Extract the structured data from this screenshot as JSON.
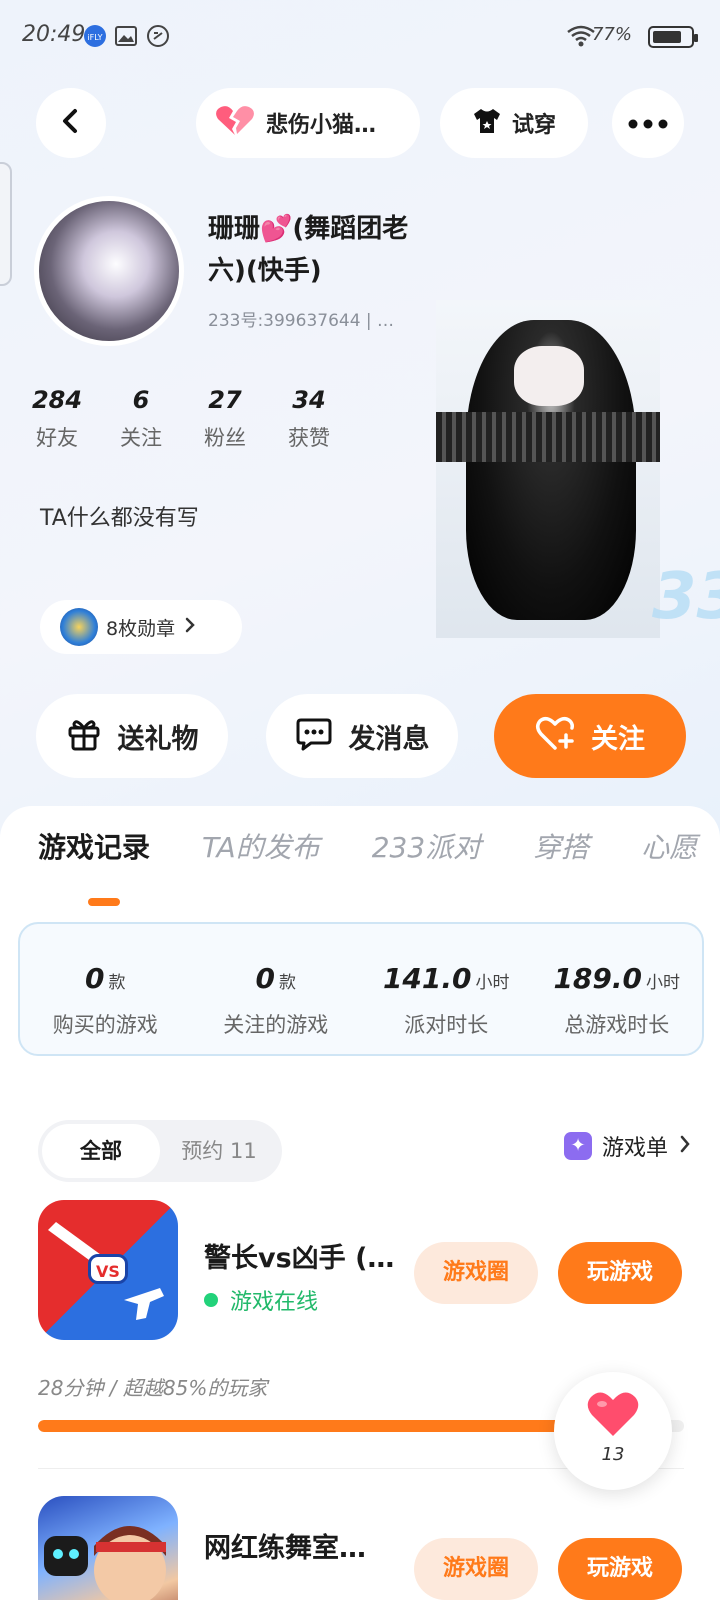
{
  "status_bar": {
    "time": "20:49",
    "battery_percent": "77%",
    "battery_level": 0.77,
    "icons": [
      "ifly-icon",
      "gallery-icon",
      "sync-icon",
      "wifi-icon",
      "battery-icon"
    ]
  },
  "top_bar": {
    "mood_label": "悲伤小猫…",
    "try_on_label": "试穿"
  },
  "profile": {
    "username": "珊珊💕(舞蹈团老六)(快手)",
    "uid": "233号:399637644 | …",
    "stats": [
      {
        "value": "284",
        "label": "好友"
      },
      {
        "value": "6",
        "label": "关注"
      },
      {
        "value": "27",
        "label": "粉丝"
      },
      {
        "value": "34",
        "label": "获赞"
      }
    ],
    "bio": "TA什么都没有写",
    "badge_label": "8枚勋章"
  },
  "actions": {
    "gift_label": "送礼物",
    "message_label": "发消息",
    "follow_label": "关注"
  },
  "tabs": [
    "游戏记录",
    "TA的发布",
    "233派对",
    "穿搭",
    "心愿"
  ],
  "active_tab": "游戏记录",
  "summary": [
    {
      "value": "0",
      "unit": "款",
      "label": "购买的游戏"
    },
    {
      "value": "0",
      "unit": "款",
      "label": "关注的游戏"
    },
    {
      "value": "141.0",
      "unit": "小时",
      "label": "派对时长"
    },
    {
      "value": "189.0",
      "unit": "小时",
      "label": "总游戏时长"
    }
  ],
  "filter": {
    "all_label": "全部",
    "reserve_label": "预约 11",
    "gamelist_label": "游戏单"
  },
  "games": [
    {
      "title": "警长vs凶手 (…",
      "online_label": "游戏在线",
      "circle_label": "游戏圈",
      "play_label": "玩游戏",
      "meta": "28分钟 / 超越85%的玩家",
      "progress": 0.85
    },
    {
      "title": "网红练舞室…",
      "circle_label": "游戏圈",
      "play_label": "玩游戏"
    }
  ],
  "like_float": {
    "count": "13"
  },
  "colors": {
    "accent": "#ff7a1a",
    "online_green": "#22b96a",
    "heart": "#ff4d6d"
  }
}
